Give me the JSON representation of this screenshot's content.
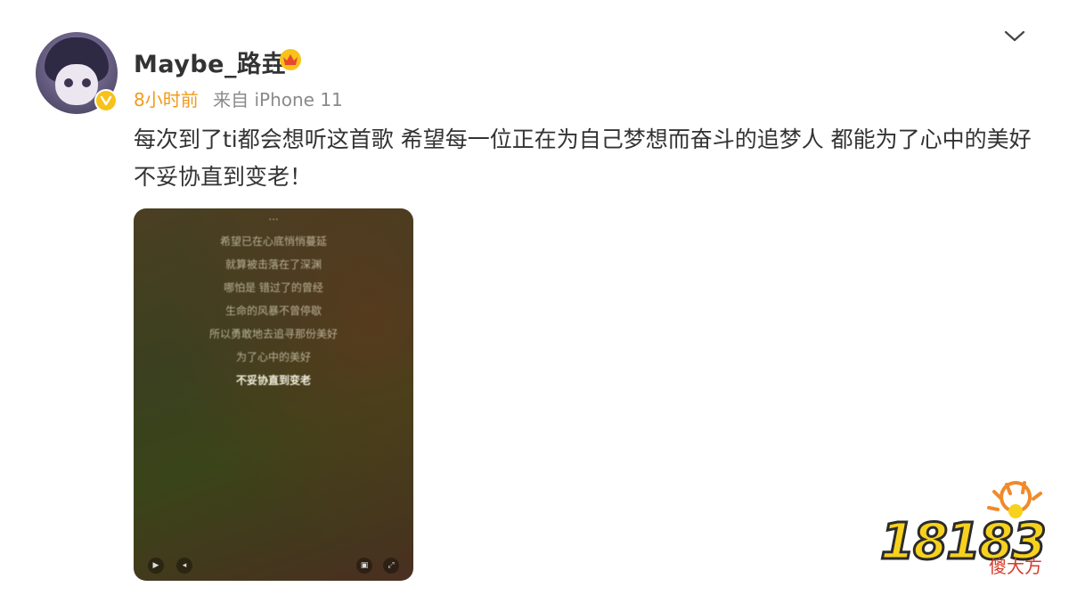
{
  "post": {
    "username": "Maybe_路垚",
    "time": "8小时前",
    "source": "来自 iPhone 11",
    "text": "每次到了ti都会想听这首歌 希望每一位正在为自己梦想而奋斗的追梦人 都能为了心中的美好不妥协直到变老！"
  },
  "video": {
    "lyrics": [
      "...",
      "希望已在心底悄悄蔓延",
      "就算被击落在了深渊",
      "哪怕是 错过了的曾经",
      "生命的风暴不曾停歇",
      "所以勇敢地去追寻那份美好",
      "为了心中的美好",
      "不妥协直到变老"
    ]
  },
  "watermark": {
    "number": "18183",
    "label": "傻大方"
  },
  "colors": {
    "time": "#f29a1b",
    "verified": "#f8c21b",
    "watermark": "#f6d21e"
  },
  "icons": [
    "verified-badge-icon",
    "vip-crown-icon",
    "chevron-down-icon",
    "play-icon",
    "volume-icon",
    "subtitle-icon",
    "fullscreen-icon"
  ]
}
